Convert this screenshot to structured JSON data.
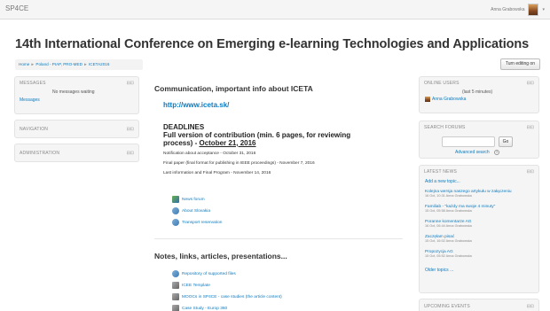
{
  "navbar": {
    "brand": "SP4CE",
    "username": "Anna Grabowska",
    "caret": "▾"
  },
  "page": {
    "title": "14th International Conference on Emerging e-learning Technologies and Applications",
    "turn_editing_label": "Turn editing on"
  },
  "breadcrumb": {
    "items": [
      "Home",
      "Poland - PIAP, PRO-MED",
      "ICETA2016"
    ],
    "separator": "►"
  },
  "left_blocks": {
    "messages": {
      "title": "MESSAGES",
      "empty_text": "No messages waiting",
      "link": "Messages",
      "icons": "⊟⊡"
    },
    "navigation": {
      "title": "NAVIGATION",
      "icons": "⊟⊡"
    },
    "administration": {
      "title": "ADMINISTRATION",
      "icons": "⊟⊡"
    }
  },
  "main": {
    "section1_title": "Communication, important info about ICETA",
    "url": "http://www.iceta.sk/",
    "deadlines_heading": "DEADLINES",
    "full_version_text": "Full version of contribution (min. 6 pages, for reviewing process) -",
    "full_version_date": "October 21, 2016",
    "deadline_lines": [
      "Notification about acceptance - October 31, 2016",
      "Final paper (final format for publishing in IEEE proceedings) - November 7, 2016",
      "Last information and Final Program - November 14, 2016"
    ],
    "resources1": [
      "News forum",
      "About Slovakia",
      "Transport reservation"
    ],
    "section2_title": "Notes, links, articles, presentations...",
    "resources2": [
      "Repository of supported files",
      "ICEE Template",
      "MOOCs in SP4CE - case studies (the article content)",
      "Case Study - Europ 360"
    ]
  },
  "right_blocks": {
    "online_users": {
      "title": "ONLINE USERS",
      "subtitle": "(last 5 minutes)",
      "user": "Anna Grabowska",
      "icons": "⊟⊡"
    },
    "search_forums": {
      "title": "SEARCH FORUMS",
      "go_label": "Go",
      "advanced_label": "Advanced search",
      "help_icon": "?",
      "icons": "⊟⊡"
    },
    "latest_news": {
      "title": "LATEST NEWS",
      "add_link": "Add a new topic...",
      "items": [
        {
          "title": "Kolejna wersja naszego artykułu w załączeniu",
          "meta": "16 Oct, 10:31 Anna Grabowska"
        },
        {
          "title": "Familiab - \"każdy ma swoje 4 minuty\"",
          "meta": "15 Oct, 05:58 Anna Grabowska"
        },
        {
          "title": "Poranne komentarze AG",
          "meta": "16 Oct, 06:44 Anna Grabowska"
        },
        {
          "title": "Zaczęłam pisać",
          "meta": "15 Oct, 16:02 Anna Grabowska"
        },
        {
          "title": "Propozycja AG",
          "meta": "15 Oct, 05:52 Anna Grabowska"
        }
      ],
      "older_link": "Older topics ...",
      "icons": "⊟⊡"
    },
    "upcoming_events": {
      "title": "UPCOMING EVENTS",
      "icons": "⊟⊡"
    }
  }
}
